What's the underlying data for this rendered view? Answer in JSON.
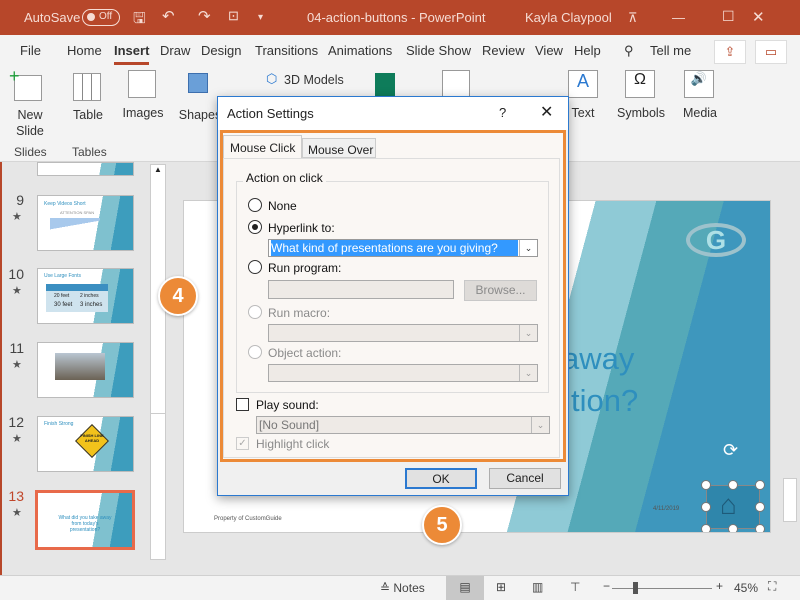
{
  "titlebar": {
    "autosave": "AutoSave",
    "autosave_state": "Off",
    "doc_title": "04-action-buttons  -  PowerPoint",
    "user": "Kayla Claypool",
    "color": "#b7472a"
  },
  "tabs": [
    "File",
    "Home",
    "Insert",
    "Draw",
    "Design",
    "Transitions",
    "Animations",
    "Slide Show",
    "Review",
    "View",
    "Help"
  ],
  "active_tab": "Insert",
  "tell_me": "Tell me",
  "ribbon": {
    "new_slide": "New",
    "new_slide2": "Slide",
    "table": "Table",
    "images": "Images",
    "shapes": "Shapes",
    "models": "3D Models",
    "text": "Text",
    "symbols": "Symbols",
    "media": "Media",
    "group_slides": "Slides",
    "group_tables": "Tables"
  },
  "thumbnails": [
    {
      "num": "9",
      "title": "Keep Videos Short",
      "subtitle": "ATTENTION SPAN"
    },
    {
      "num": "10",
      "title": "Use Large Fonts",
      "rows": [
        "20 feet",
        "30 feet"
      ],
      "rows2": [
        "2 inches",
        "3 inches"
      ]
    },
    {
      "num": "11"
    },
    {
      "num": "12",
      "title": "Finish Strong",
      "sign": "FINISH LINE AHEAD"
    },
    {
      "num": "13",
      "title": "What did you take away from today's presentation?",
      "selected": true
    }
  ],
  "slide": {
    "line1": "away",
    "line2": "tion?",
    "footer": "Property of CustomGuide",
    "date": "4/11/2019"
  },
  "dialog": {
    "title": "Action Settings",
    "help": "?",
    "close": "X",
    "tabs": [
      "Mouse Click",
      "Mouse Over"
    ],
    "group": "Action on click",
    "none": "None",
    "hyperlink": "Hyperlink to:",
    "hyperlink_value": "What kind of presentations are you giving?",
    "run_program": "Run program:",
    "browse": "Browse...",
    "run_macro": "Run macro:",
    "object_action": "Object action:",
    "play_sound": "Play sound:",
    "sound_value": "[No Sound]",
    "highlight": "Highlight click",
    "ok": "OK",
    "cancel": "Cancel",
    "selected_action": "Hyperlink to:"
  },
  "callouts": [
    "4",
    "5"
  ],
  "status": {
    "notes": "Notes",
    "zoom": "45%",
    "zoom_level": 45
  }
}
